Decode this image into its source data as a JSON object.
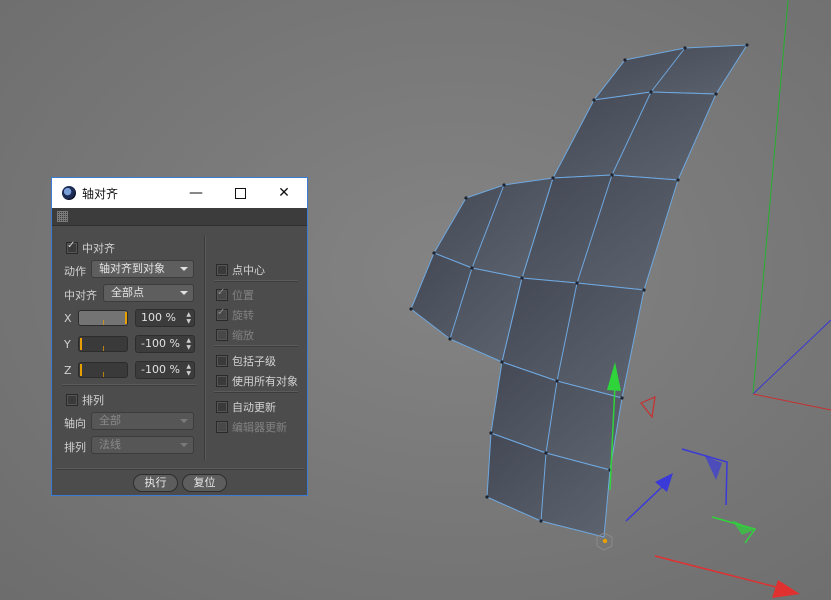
{
  "window": {
    "title": "轴对齐",
    "icon": "cinema4d-icon",
    "controls": [
      "minimize-icon",
      "maximize-icon",
      "close-icon"
    ]
  },
  "left": {
    "center_align": {
      "label": "中对齐",
      "checked": true
    },
    "action": {
      "label": "动作",
      "value": "轴对齐到对象"
    },
    "center_align_mode": {
      "label": "中对齐",
      "value": "全部点"
    },
    "x": {
      "label": "X",
      "value": "100 %",
      "level": 1.0
    },
    "y": {
      "label": "Y",
      "value": "-100 %",
      "level": 0.0
    },
    "z": {
      "label": "Z",
      "value": "-100 %",
      "level": 0.0
    },
    "arrange": {
      "label": "排列",
      "checked": false
    },
    "axis": {
      "label": "轴向",
      "value": "全部",
      "disabled": true
    },
    "arrange_mode": {
      "label": "排列",
      "value": "法线",
      "disabled": true
    }
  },
  "right": {
    "point_center": {
      "label": "点中心",
      "checked": false
    },
    "position": {
      "label": "位置",
      "checked": true,
      "disabled": true
    },
    "rotation": {
      "label": "旋转",
      "checked": true,
      "disabled": true
    },
    "scale": {
      "label": "缩放",
      "checked": false,
      "disabled": true
    },
    "include_children": {
      "label": "包括子级",
      "checked": false
    },
    "use_all_objects": {
      "label": "使用所有对象",
      "checked": false
    },
    "auto_update": {
      "label": "自动更新",
      "checked": false
    },
    "editor_update": {
      "label": "编辑器更新",
      "checked": false,
      "disabled": true
    }
  },
  "footer": {
    "execute": "执行",
    "reset": "复位"
  },
  "colors": {
    "viewport_bg": "#7a7a7a",
    "mesh_fill": "#4f5663",
    "mesh_edge": "#6fa8e0",
    "axis_y": "#2fd33a",
    "axis_x": "#e03030",
    "axis_z": "#3a3ad8",
    "accent": "#e8a000"
  }
}
